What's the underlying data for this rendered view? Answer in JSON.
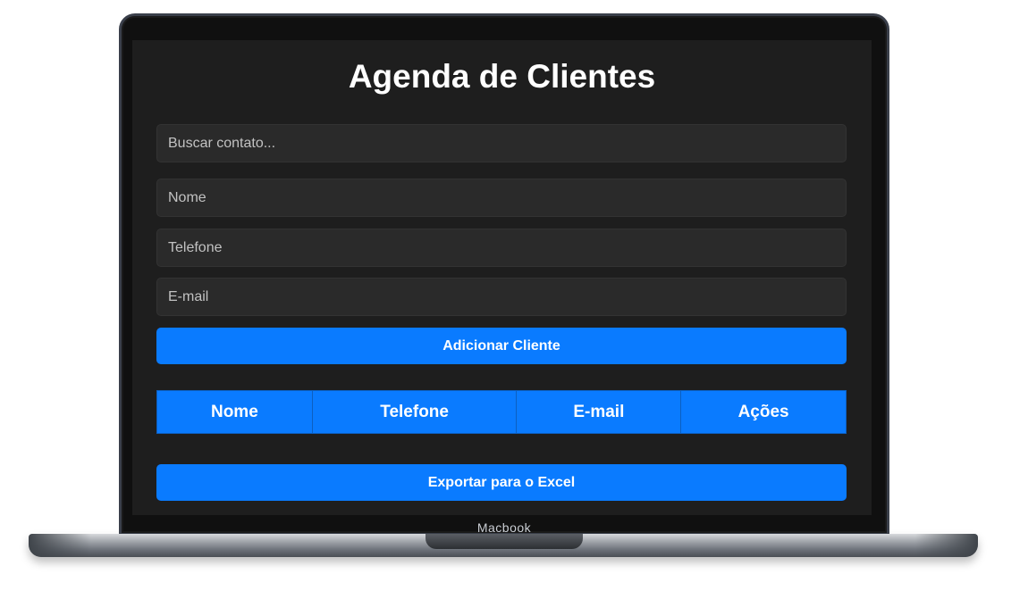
{
  "device": {
    "brand_label": "Macbook"
  },
  "app": {
    "title": "Agenda de Clientes",
    "search": {
      "placeholder": "Buscar contato...",
      "value": ""
    },
    "form": {
      "name": {
        "placeholder": "Nome",
        "value": ""
      },
      "phone": {
        "placeholder": "Telefone",
        "value": ""
      },
      "email": {
        "placeholder": "E-mail",
        "value": ""
      },
      "add_label": "Adicionar Cliente"
    },
    "table": {
      "headers": [
        "Nome",
        "Telefone",
        "E-mail",
        "Ações"
      ],
      "rows": []
    },
    "export_label": "Exportar para o Excel",
    "accent_color": "#0a7bff",
    "background_color": "#1e1e1e"
  }
}
